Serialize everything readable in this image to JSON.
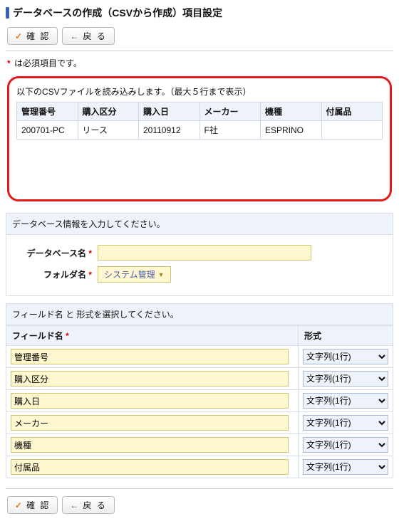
{
  "title": "データベースの作成（CSVから作成）項目設定",
  "buttons": {
    "confirm": "確 認",
    "back": "戻 る"
  },
  "required_note": "は必須項目です。",
  "csv": {
    "caption": "以下のCSVファイルを読み込みします。（最大５行まで表示）",
    "headers": [
      "管理番号",
      "購入区分",
      "購入日",
      "メーカー",
      "機種",
      "付属品"
    ],
    "rows": [
      [
        "200701-PC",
        "リース",
        "20110912",
        "F社",
        "ESPRINO",
        ""
      ]
    ]
  },
  "db_info": {
    "section_title": "データベース情報を入力してください。",
    "db_name_label": "データベース名",
    "db_name_value": "",
    "folder_label": "フォルダ名",
    "folder_value": "システム管理"
  },
  "fields": {
    "section_title": "フィールド名 と 形式を選択してください。",
    "col_name": "フィールド名",
    "col_type": "形式",
    "type_option": "文字列(1行)",
    "rows": [
      "管理番号",
      "購入区分",
      "購入日",
      "メーカー",
      "機種",
      "付属品"
    ]
  }
}
